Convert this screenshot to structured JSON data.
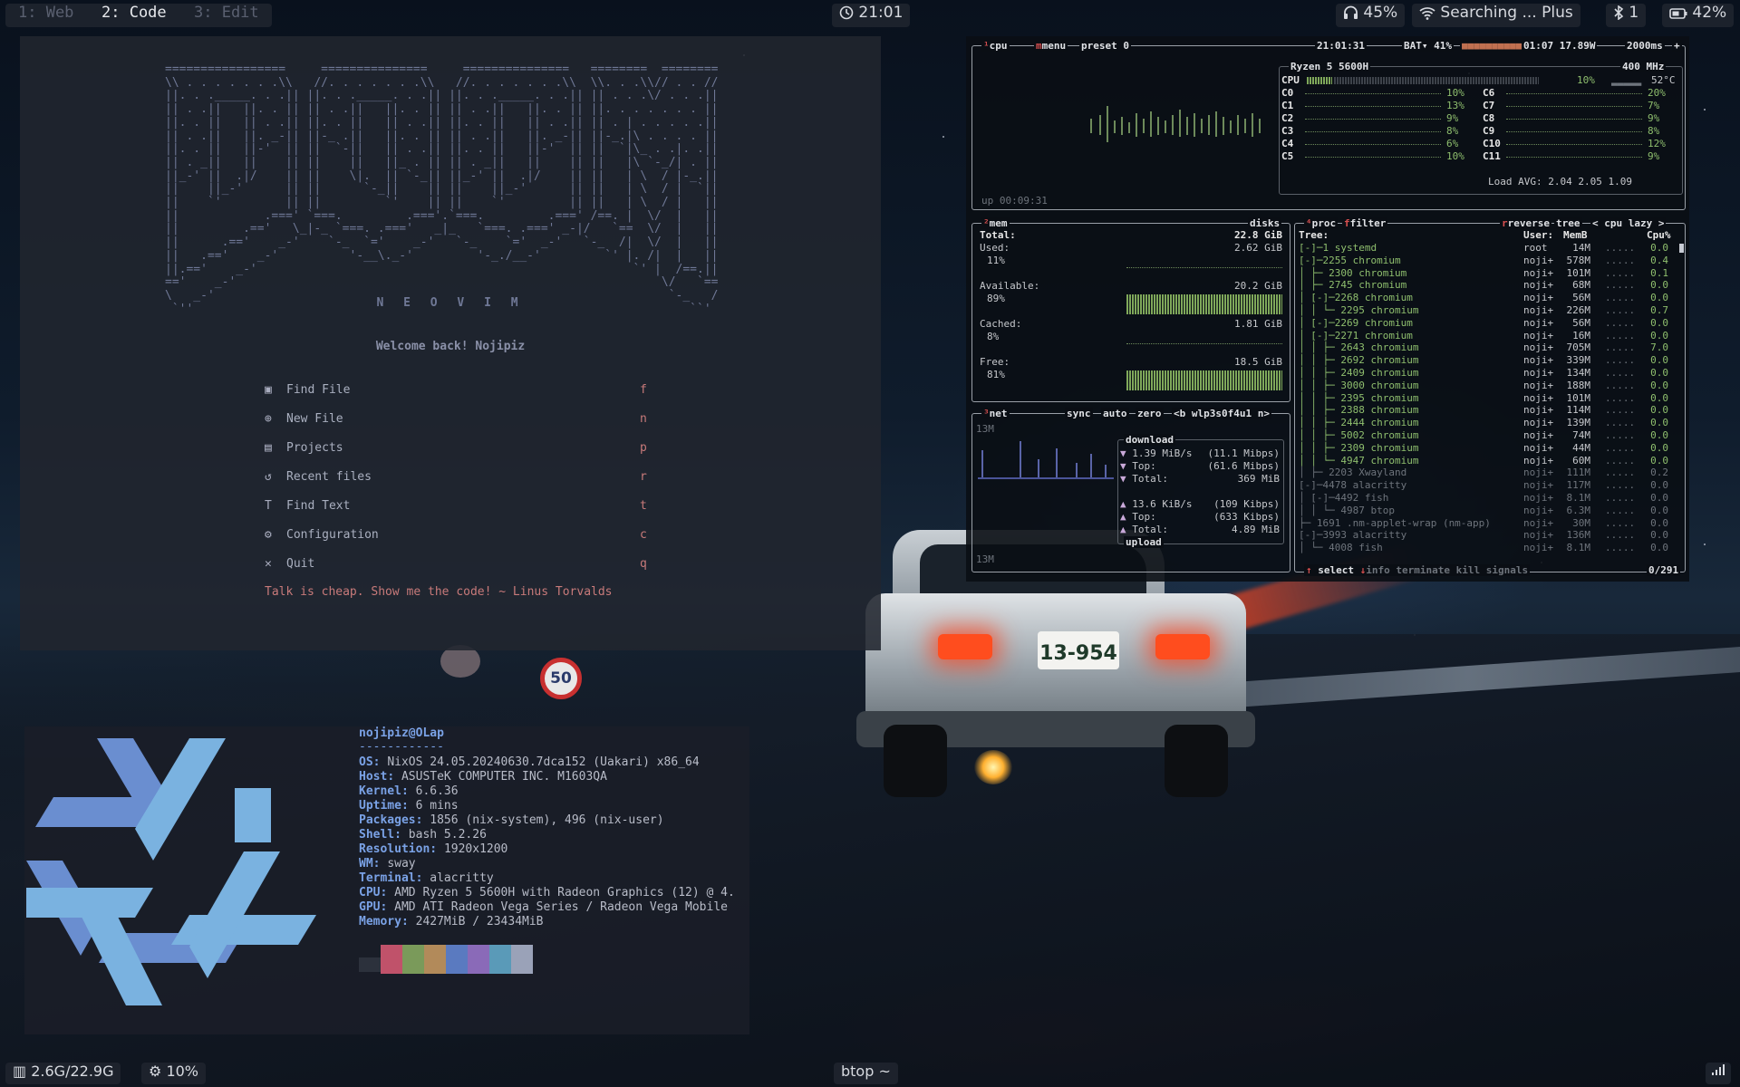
{
  "topbar": {
    "workspaces": [
      {
        "label": "1: Web",
        "active": false
      },
      {
        "label": "2: Code",
        "active": true
      },
      {
        "label": "3: Edit",
        "active": false
      }
    ],
    "clock": "21:01",
    "audio": "45%",
    "wifi": "Searching ... Plus",
    "bluetooth": "1",
    "battery": "42%"
  },
  "nvim": {
    "ascii_logo": "=================     ===============     ===============   ========  ========\n\\\\ . . . . . . .\\\\   //. . . . . . .\\\\   //. . . . . . .\\\\  \\\\. . .\\\\// . . //\n||. . ._____. . .|| ||. . ._____. . .|| ||. . ._____. . .|| || . . .\\/ . . .||\n|| . .||   ||. . || || . .||   ||. . || || . .||   ||. . || ||. . . . . . . ||\n||. . ||   || . .|| ||. . ||   || . .|| ||. . ||   || . .|| || . | . . . . .||\n|| . .||   ||. _-|| ||-_ .||   ||. . || || . .||   ||. _-|| ||-_.|\\ . . . . ||\n||. . ||   ||-'  || ||  `-||   || . .|| ||. . ||   ||-'  || ||  `|\\_ . .|. .||\n|| . _||   ||    || ||    ||   ||_ . || || . _||   ||    || ||   |\\ `-_/| . ||\n||_-' ||  .|/    || ||    \\|.  || `-_|| ||_-' ||  .|/    || ||   | \\  / |-_.||\n||    ||_-'      || ||      `-_||    || ||    ||_-'      || ||   | \\  / |  `||\n||    `'         || ||         `'    || ||    `'         || ||   | \\  / |   ||\n||            .===' `===.         .==='.`===.         .===' /==. |  \\/  |   ||\n||         .=='   \\_|-_ `===. .==='   _|_   `===. .===' _-|/   `==  \\/  |   ||\n||      .=='    _-'    `-_  `='    _-'   `-_    `='  _-'   `-_  /|  \\/  |   ||\n||   .=='    _-'          '-__\\._-'         '-_./__-'         `' |. /|  |   ||\n||.=='    _-'                                                     `' |  /==.||\n=='    _-'                                                            \\/   `==\n\\   _-'                                                                `-_   /\n `''                                                                      ``'",
    "title": "N E O V I M",
    "welcome": "Welcome back! Nojipiz",
    "menu": [
      {
        "icon": "file-search-icon",
        "label": "Find File",
        "key": "f"
      },
      {
        "icon": "new-file-icon",
        "label": "New File",
        "key": "n"
      },
      {
        "icon": "projects-icon",
        "label": "Projects",
        "key": "p"
      },
      {
        "icon": "history-icon",
        "label": "Recent files",
        "key": "r"
      },
      {
        "icon": "text-icon",
        "label": "Find Text",
        "key": "t"
      },
      {
        "icon": "gear-icon",
        "label": "Configuration",
        "key": "c"
      },
      {
        "icon": "close-icon",
        "label": "Quit",
        "key": "q"
      }
    ],
    "quote": "Talk is cheap. Show me the code! ~ Linus Torvalds"
  },
  "btop": {
    "cpu_box": {
      "tab_cpu": "cpu",
      "tab_menu": "menu",
      "preset": "preset 0",
      "time": "21:01:31",
      "battery": "BAT▾ 41%",
      "battery_time": "01:07 17.89W",
      "interval": "2000ms",
      "model": "Ryzen 5 5600H",
      "freq": "400 MHz",
      "cpu_total": "10%",
      "temp": "52°C",
      "cores_left": [
        {
          "n": "C0",
          "v": "10%"
        },
        {
          "n": "C1",
          "v": "13%"
        },
        {
          "n": "C2",
          "v": "9%"
        },
        {
          "n": "C3",
          "v": "8%"
        },
        {
          "n": "C4",
          "v": "6%"
        },
        {
          "n": "C5",
          "v": "10%"
        }
      ],
      "cores_right": [
        {
          "n": "C6",
          "v": "20%"
        },
        {
          "n": "C7",
          "v": "7%"
        },
        {
          "n": "C8",
          "v": "9%"
        },
        {
          "n": "C9",
          "v": "8%"
        },
        {
          "n": "C10",
          "v": "12%"
        },
        {
          "n": "C11",
          "v": "9%"
        }
      ],
      "load_avg": "Load AVG:   2.04   2.05   1.09",
      "uptime": "up 00:09:31"
    },
    "mem_box": {
      "tab_mem": "mem",
      "tab_disks": "disks",
      "total_label": "Total:",
      "total": "22.8 GiB",
      "used_label": "Used:",
      "used": "2.62 GiB",
      "used_pct": "11%",
      "avail_label": "Available:",
      "avail": "20.2 GiB",
      "avail_pct": "89%",
      "cached_label": "Cached:",
      "cached": "1.81 GiB",
      "cached_pct": "8%",
      "free_label": "Free:",
      "free": "18.5 GiB",
      "free_pct": "81%"
    },
    "net_box": {
      "tab_net": "net",
      "sync": "sync",
      "auto": "auto",
      "zero": "zero",
      "iface": "<b wlp3s0f4u1 n>",
      "scale_top": "13M",
      "scale_bottom": "13M",
      "download": "download",
      "dl_rate": "1.39 MiB/s",
      "dl_rate_b": "(11.1 Mibps)",
      "dl_top": "Top:",
      "dl_top_v": "(61.6 Mibps)",
      "dl_total": "Total:",
      "dl_total_v": "369 MiB",
      "ul_rate": "13.6 KiB/s",
      "ul_rate_b": "(109 Kibps)",
      "ul_top": "Top:",
      "ul_top_v": "(633 Kibps)",
      "ul_total": "Total:",
      "ul_total_v": "4.89 MiB",
      "upload": "upload"
    },
    "proc_box": {
      "tab_proc": "proc",
      "filter": "filter",
      "reverse": "reverse",
      "tree": "tree",
      "sort": "< cpu lazy >",
      "col_tree": "Tree:",
      "col_user": "User:",
      "col_mem": "MemB",
      "col_cpu": "Cpu%",
      "rows": [
        {
          "t": "[-]─1 systemd",
          "u": "root",
          "m": "14M",
          "c": "0.0",
          "dim": false
        },
        {
          "t": "  [-]─2255 chromium",
          "u": "noji+",
          "m": "578M",
          "c": "0.4",
          "dim": false
        },
        {
          "t": "   │  ├─ 2300 chromium",
          "u": "noji+",
          "m": "101M",
          "c": "0.1",
          "dim": false
        },
        {
          "t": "   │  ├─ 2745 chromium",
          "u": "noji+",
          "m": "68M",
          "c": "0.0",
          "dim": false
        },
        {
          "t": "   │ [-]─2268 chromium",
          "u": "noji+",
          "m": "56M",
          "c": "0.0",
          "dim": false
        },
        {
          "t": "   │  │  └─ 2295 chromium",
          "u": "noji+",
          "m": "226M",
          "c": "0.7",
          "dim": false
        },
        {
          "t": "   │ [-]─2269 chromium",
          "u": "noji+",
          "m": "56M",
          "c": "0.0",
          "dim": false
        },
        {
          "t": "   │    [-]─2271 chromium",
          "u": "noji+",
          "m": "16M",
          "c": "0.0",
          "dim": false
        },
        {
          "t": "   │     │   ├─ 2643 chromium",
          "u": "noji+",
          "m": "705M",
          "c": "7.0",
          "dim": false
        },
        {
          "t": "   │     │   ├─ 2692 chromium",
          "u": "noji+",
          "m": "339M",
          "c": "0.0",
          "dim": false
        },
        {
          "t": "   │     │   ├─ 2409 chromium",
          "u": "noji+",
          "m": "134M",
          "c": "0.0",
          "dim": false
        },
        {
          "t": "   │     │   ├─ 3000 chromium",
          "u": "noji+",
          "m": "188M",
          "c": "0.0",
          "dim": false
        },
        {
          "t": "   │     │   ├─ 2395 chromium",
          "u": "noji+",
          "m": "101M",
          "c": "0.0",
          "dim": false
        },
        {
          "t": "   │     │   ├─ 2388 chromium",
          "u": "noji+",
          "m": "114M",
          "c": "0.0",
          "dim": false
        },
        {
          "t": "   │     │   ├─ 2444 chromium",
          "u": "noji+",
          "m": "139M",
          "c": "0.0",
          "dim": false
        },
        {
          "t": "   │     │   ├─ 5002 chromium",
          "u": "noji+",
          "m": "74M",
          "c": "0.0",
          "dim": false
        },
        {
          "t": "   │     │   ├─ 2309 chromium",
          "u": "noji+",
          "m": "44M",
          "c": "0.0",
          "dim": false
        },
        {
          "t": "   │     │   └─ 4947 chromium",
          "u": "noji+",
          "m": "60M",
          "c": "0.0",
          "dim": false
        },
        {
          "t": "   │  ├─ 2203 Xwayland",
          "u": "noji+",
          "m": "111M",
          "c": "0.2",
          "dim": true
        },
        {
          "t": "  [-]─4478 alacritty",
          "u": "noji+",
          "m": "117M",
          "c": "0.0",
          "dim": true
        },
        {
          "t": "   │ [-]─4492 fish",
          "u": "noji+",
          "m": "8.1M",
          "c": "0.0",
          "dim": true
        },
        {
          "t": "   │  │  └─ 4987 btop",
          "u": "noji+",
          "m": "6.3M",
          "c": "0.0",
          "dim": true
        },
        {
          "t": "   ├─ 1691 .nm-applet-wrap (nm-app)",
          "u": "noji+",
          "m": "30M",
          "c": "0.0",
          "dim": true
        },
        {
          "t": "  [-]─3993 alacritty",
          "u": "noji+",
          "m": "136M",
          "c": "0.0",
          "dim": true
        },
        {
          "t": "   │  └─ 4008 fish",
          "u": "noji+",
          "m": "8.1M",
          "c": "0.0",
          "dim": true
        }
      ],
      "footer_select": "select",
      "footer_info": "info",
      "footer_terminate": "terminate",
      "footer_kill": "kill",
      "footer_signals": "signals",
      "count": "0/291"
    }
  },
  "fastfetch": {
    "title": "nojipiz@OLap",
    "separator": "------------",
    "lines": [
      {
        "k": "OS",
        "v": "NixOS 24.05.20240630.7dca152 (Uakari) x86_64"
      },
      {
        "k": "Host",
        "v": "ASUSTeK COMPUTER INC. M1603QA"
      },
      {
        "k": "Kernel",
        "v": "6.6.36"
      },
      {
        "k": "Uptime",
        "v": "6 mins"
      },
      {
        "k": "Packages",
        "v": "1856 (nix-system), 496 (nix-user)"
      },
      {
        "k": "Shell",
        "v": "bash 5.2.26"
      },
      {
        "k": "Resolution",
        "v": "1920x1200"
      },
      {
        "k": "WM",
        "v": "sway"
      },
      {
        "k": "Terminal",
        "v": "alacritty"
      },
      {
        "k": "CPU",
        "v": "AMD Ryzen 5 5600H with Radeon Graphics (12) @ 4."
      },
      {
        "k": "GPU",
        "v": "AMD ATI Radeon Vega Series / Radeon Vega Mobile"
      },
      {
        "k": "Memory",
        "v": "2427MiB / 23434MiB"
      }
    ],
    "palette": [
      "#2c313c",
      "#c0526a",
      "#7a9a5a",
      "#b28a5a",
      "#5a7ac0",
      "#8a6ab8",
      "#5a9ab8",
      "#9aa2b8"
    ]
  },
  "bottombar": {
    "memory": "2.6G/22.9G",
    "cpu": "10%",
    "window_title": "btop ~"
  },
  "wallpaper": {
    "plate": "13-954",
    "sign": "50"
  }
}
